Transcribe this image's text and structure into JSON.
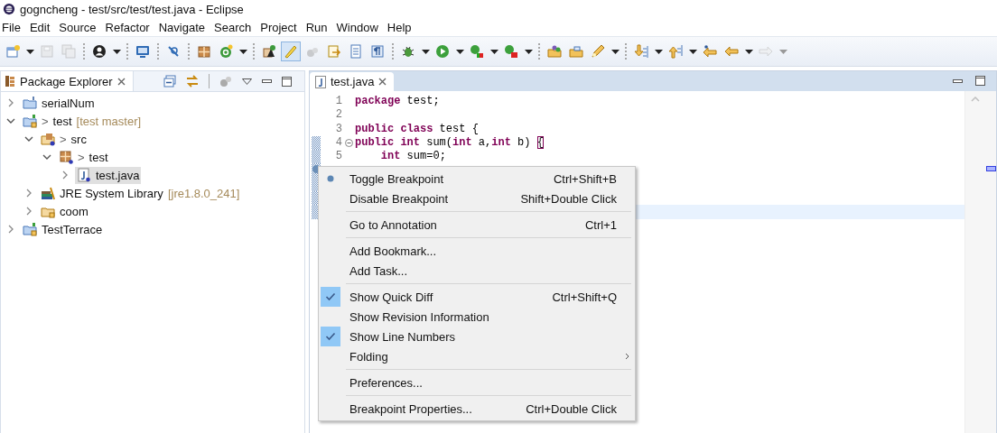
{
  "window": {
    "title": "gogncheng - test/src/test/test.java - Eclipse"
  },
  "menu_bar": [
    "File",
    "Edit",
    "Source",
    "Refactor",
    "Navigate",
    "Search",
    "Project",
    "Run",
    "Window",
    "Help"
  ],
  "toolbar": [
    [
      {
        "kind": "new-file",
        "dropdown": true,
        "pressed": false,
        "disabled": false
      },
      {
        "kind": "save",
        "dropdown": false,
        "pressed": false,
        "disabled": true
      },
      {
        "kind": "save-all",
        "dropdown": false,
        "pressed": false,
        "disabled": true
      }
    ],
    [
      {
        "kind": "person",
        "dropdown": true,
        "pressed": false,
        "disabled": false
      }
    ],
    [
      {
        "kind": "monitor",
        "dropdown": false,
        "pressed": false,
        "disabled": false
      }
    ],
    [
      {
        "kind": "pin",
        "dropdown": false,
        "pressed": false,
        "disabled": false
      }
    ],
    [
      {
        "kind": "package",
        "dropdown": false,
        "pressed": false,
        "disabled": false
      },
      {
        "kind": "new-class",
        "dropdown": true,
        "pressed": false,
        "disabled": false
      }
    ],
    [
      {
        "kind": "hierarchy",
        "dropdown": false,
        "pressed": false,
        "disabled": false
      },
      {
        "kind": "highlighter",
        "dropdown": false,
        "pressed": true,
        "disabled": false
      },
      {
        "kind": "beans",
        "dropdown": false,
        "pressed": false,
        "disabled": true
      },
      {
        "kind": "task",
        "dropdown": false,
        "pressed": false,
        "disabled": false
      },
      {
        "kind": "document",
        "dropdown": false,
        "pressed": false,
        "disabled": false
      },
      {
        "kind": "paragraph",
        "dropdown": false,
        "pressed": false,
        "disabled": false
      }
    ],
    [
      {
        "kind": "bug",
        "dropdown": true,
        "pressed": false,
        "disabled": false
      },
      {
        "kind": "run",
        "dropdown": true,
        "pressed": false,
        "disabled": false
      },
      {
        "kind": "coverage",
        "dropdown": true,
        "pressed": false,
        "disabled": false
      },
      {
        "kind": "run-external",
        "dropdown": true,
        "pressed": false,
        "disabled": false
      }
    ],
    [
      {
        "kind": "open-project",
        "dropdown": false,
        "pressed": false,
        "disabled": false
      },
      {
        "kind": "folder",
        "dropdown": false,
        "pressed": false,
        "disabled": false
      },
      {
        "kind": "pen",
        "dropdown": true,
        "pressed": false,
        "disabled": false
      }
    ],
    [
      {
        "kind": "next-annotation",
        "dropdown": true,
        "pressed": false,
        "disabled": false
      },
      {
        "kind": "prev-annotation",
        "dropdown": true,
        "pressed": false,
        "disabled": false
      },
      {
        "kind": "last-edit",
        "dropdown": false,
        "pressed": false,
        "disabled": false
      },
      {
        "kind": "back",
        "dropdown": true,
        "pressed": false,
        "disabled": false
      },
      {
        "kind": "forward",
        "dropdown": true,
        "pressed": false,
        "disabled": true
      }
    ]
  ],
  "package_explorer": {
    "title": "Package Explorer",
    "tree": [
      {
        "kind": "java-project",
        "label": "serialNum",
        "expandable": true,
        "expanded": false,
        "selected": false
      },
      {
        "kind": "git-project",
        "dirty_mark": ">",
        "label": "test",
        "decoration": "[test master]",
        "expandable": true,
        "expanded": true,
        "selected": false,
        "children": [
          {
            "kind": "source-folder",
            "dirty_mark": ">",
            "label": "src",
            "expandable": true,
            "expanded": true,
            "selected": false,
            "children": [
              {
                "kind": "package",
                "dirty_mark": ">",
                "label": "test",
                "expandable": true,
                "expanded": true,
                "selected": false,
                "children": [
                  {
                    "kind": "java-file",
                    "label": "test.java",
                    "expandable": true,
                    "expanded": false,
                    "selected": true
                  }
                ]
              }
            ]
          },
          {
            "kind": "library",
            "label": "JRE System Library",
            "decoration": "[jre1.8.0_241]",
            "expandable": true,
            "expanded": false,
            "selected": false
          },
          {
            "kind": "folder",
            "label": "coom",
            "expandable": true,
            "expanded": false,
            "selected": false
          }
        ]
      },
      {
        "kind": "git-project",
        "label": "TestTerrace",
        "expandable": true,
        "expanded": false,
        "selected": false
      }
    ]
  },
  "editor": {
    "tab": {
      "title": "test.java",
      "selected": true
    },
    "lines": [
      {
        "number": "1",
        "tokens": [
          {
            "kind": "keyword",
            "text": "package"
          },
          {
            "kind": "plain",
            "text": " test;"
          }
        ],
        "foldable": false,
        "changed": false,
        "breakpoint": false,
        "current": false
      },
      {
        "number": "2",
        "foldable": false,
        "changed": false,
        "breakpoint": false,
        "current": false
      },
      {
        "number": "3",
        "tokens": [
          {
            "kind": "keyword",
            "text": "public class"
          },
          {
            "kind": "plain",
            "text": " test {"
          }
        ],
        "foldable": false,
        "changed": false,
        "breakpoint": false,
        "current": false
      },
      {
        "number": "4",
        "tokens": [
          {
            "kind": "keyword",
            "text": "public int"
          },
          {
            "kind": "plain",
            "text": " sum("
          },
          {
            "kind": "keyword",
            "text": "int"
          },
          {
            "kind": "plain",
            "text": " a,"
          },
          {
            "kind": "keyword",
            "text": "int"
          },
          {
            "kind": "plain",
            "text": " b) "
          },
          {
            "kind": "bracket",
            "text": "{"
          }
        ],
        "foldable": true,
        "changed": true,
        "breakpoint": false,
        "current": false
      },
      {
        "number": "5",
        "tokens": [
          {
            "kind": "keyword",
            "text": "    int"
          },
          {
            "kind": "plain",
            "text": " sum=0;"
          }
        ],
        "foldable": false,
        "changed": true,
        "breakpoint": false,
        "current": false
      },
      {
        "changed": true,
        "breakpoint": true,
        "current": false
      },
      {
        "changed": true,
        "breakpoint": false,
        "current": false
      },
      {
        "changed": true,
        "breakpoint": false,
        "current": false
      },
      {
        "changed": true,
        "breakpoint": false,
        "current": true
      }
    ]
  },
  "context_menu": {
    "groups": [
      [
        {
          "kind": "breakpoint",
          "label": "Toggle Breakpoint",
          "shortcut": "Ctrl+Shift+B",
          "checked": false,
          "submenu": false
        },
        {
          "kind": "command",
          "label": "Disable Breakpoint",
          "shortcut": "Shift+Double Click",
          "checked": false,
          "submenu": false
        }
      ],
      [
        {
          "kind": "command",
          "label": "Go to Annotation",
          "shortcut": "Ctrl+1",
          "checked": false,
          "submenu": false
        }
      ],
      [
        {
          "kind": "command",
          "label": "Add Bookmark...",
          "checked": false,
          "submenu": false
        },
        {
          "kind": "command",
          "label": "Add Task...",
          "checked": false,
          "submenu": false
        }
      ],
      [
        {
          "kind": "command",
          "label": "Show Quick Diff",
          "shortcut": "Ctrl+Shift+Q",
          "checked": true,
          "submenu": false
        },
        {
          "kind": "command",
          "label": "Show Revision Information",
          "checked": false,
          "submenu": false
        },
        {
          "kind": "command",
          "label": "Show Line Numbers",
          "checked": true,
          "submenu": false
        },
        {
          "kind": "command",
          "label": "Folding",
          "checked": false,
          "submenu": true
        }
      ],
      [
        {
          "kind": "command",
          "label": "Preferences...",
          "checked": false,
          "submenu": false
        }
      ],
      [
        {
          "kind": "command",
          "label": "Breakpoint Properties...",
          "shortcut": "Ctrl+Double Click",
          "checked": false,
          "submenu": false
        }
      ]
    ]
  }
}
